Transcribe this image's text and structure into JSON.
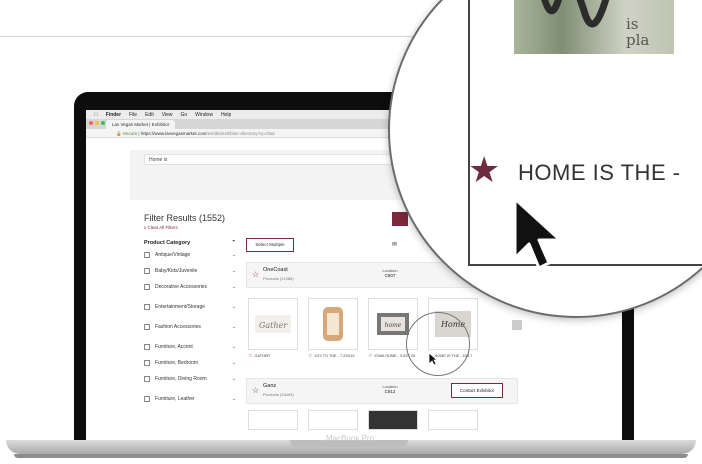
{
  "menubar": {
    "apple": "",
    "items": [
      "Finder",
      "File",
      "Edit",
      "View",
      "Go",
      "Window",
      "Help"
    ]
  },
  "browser": {
    "tab_title": "Las Vegas Market | Exhibitor",
    "address_secure": "Secure",
    "address_url": "https://www.lasvegasmarket.com",
    "address_path": "/exhibit/exhibitor-directory?q=chair"
  },
  "search": {
    "value": "Home is"
  },
  "filters": {
    "title": "Filter Results (1552)",
    "clear": "x Clear All Filters",
    "select_multiple": "Select Multiple"
  },
  "sidebar": {
    "heading": "Product Category",
    "items": [
      {
        "label": "Antique/Vintage"
      },
      {
        "label": "Baby/Kids/Juvenile"
      },
      {
        "label": "Decorative Accessories"
      },
      {
        "label": "Entertainment/Storage"
      },
      {
        "label": "Fashion Accessories"
      },
      {
        "label": "Furniture, Accent"
      },
      {
        "label": "Furniture, Bedroom"
      },
      {
        "label": "Furniture, Dining Room"
      },
      {
        "label": "Furniture, Leather"
      }
    ]
  },
  "exhibitors": [
    {
      "name": "OneCoast",
      "products": "Products (21986)",
      "location_label": "Location",
      "location": "C807"
    },
    {
      "name": "Ganz",
      "products": "Products (33493)",
      "location_label": "Location",
      "location": "C912",
      "contact": "Contact Exhibitor"
    }
  ],
  "products": [
    {
      "label": "GATHER"
    },
    {
      "label": "JOY TO THE - 7.2SX19"
    },
    {
      "label": "IOWA HOME - 9.5X7.25"
    },
    {
      "label": "HOME IS THE - 4X3.7"
    }
  ],
  "magnifier": {
    "label": "HOME IS THE -",
    "text_fragment_1": "is",
    "text_fragment_2": "pla"
  },
  "laptop": {
    "model": "MacBook Pro"
  },
  "colors": {
    "accent": "#7a2a3a",
    "star": "#6e2c3f"
  }
}
